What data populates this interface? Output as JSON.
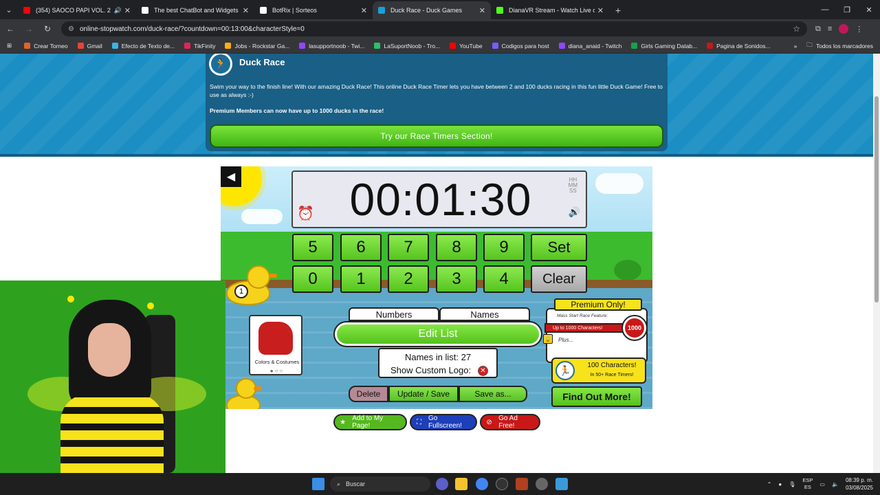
{
  "browser": {
    "tabs": [
      {
        "label": "(354) SAOCO PAPI VOL. 2",
        "color": "#ff0000",
        "active": false
      },
      {
        "label": "The best ChatBot and Widgets",
        "color": "#ffffff",
        "active": false
      },
      {
        "label": "BotRix | Sorteos",
        "color": "#ffffff",
        "active": false
      },
      {
        "label": "Duck Race - Duck Games",
        "color": "#1aa0d8",
        "active": true
      },
      {
        "label": "DianaVR Stream - Watch Live o",
        "color": "#53fc18",
        "active": false
      }
    ],
    "url": "online-stopwatch.com/duck-race/?countdown=00:13:00&characterStyle=0",
    "bookmarks": [
      {
        "label": "Crear Torneo",
        "color": "#e0632a"
      },
      {
        "label": "Gmail",
        "color": "#ea4335"
      },
      {
        "label": "Efecto de Texto de...",
        "color": "#3bb3e6"
      },
      {
        "label": "TikFinity",
        "color": "#e2245a"
      },
      {
        "label": "Jobs - Rockstar Ga...",
        "color": "#fcaf17"
      },
      {
        "label": "lasupportnoob - Twi...",
        "color": "#9146ff"
      },
      {
        "label": "LaSuportNoob - Tro...",
        "color": "#2bbf6a"
      },
      {
        "label": "YouTube",
        "color": "#ff0000"
      },
      {
        "label": "Codigos para host",
        "color": "#7b5cff"
      },
      {
        "label": "diana_anaid - Twitch",
        "color": "#9146ff"
      },
      {
        "label": "Girls Gaming Datab...",
        "color": "#16a34a"
      },
      {
        "label": "Pagina de Sonidos...",
        "color": "#c81818"
      }
    ],
    "all_bookmarks": "Todos los marcadores"
  },
  "hero": {
    "title": "Duck Race",
    "description": "Swim your way to the finish line! With our amazing Duck Race! This online Duck Race Timer lets you have between 2 and 100 ducks racing in this fun little Duck Game! Free to use as always :-)",
    "premium": "Premium Members can now have up to 1000 ducks in the race!",
    "cta": "Try our Race Timers Section!"
  },
  "game": {
    "timer": "00:01:30",
    "format": [
      "HH",
      "MM",
      "SS"
    ],
    "keys_row1": [
      "5",
      "6",
      "7",
      "8",
      "9",
      "Set"
    ],
    "keys_row2": [
      "0",
      "1",
      "2",
      "3",
      "4",
      "Clear"
    ],
    "duck_number": "1",
    "costume_label": "Colors & Costumes",
    "tab_numbers": "Numbers",
    "tab_names": "Names",
    "edit_list": "Edit List",
    "names_in_list": "Names in list: 27",
    "show_custom_logo": "Show Custom Logo:",
    "btn_delete": "Delete",
    "btn_update": "Update / Save",
    "btn_save_as": "Save as...",
    "premium_only": "Premium Only!",
    "mass_start": "Mass Start Race Feature:",
    "up_to": "Up to 1000 Characters!",
    "thousand": "1000",
    "plus": "Plus...",
    "hundred_a": "100 Characters!",
    "hundred_b": "In 50+ Race Timers!",
    "find_out": "Find Out More!"
  },
  "sub_buttons": {
    "add": "Add to My Page!",
    "fullscreen": "Go Fullscreen!",
    "adfree": "Go Ad Free!"
  },
  "taskbar": {
    "search": "Buscar",
    "lang1": "ESP",
    "lang2": "ES",
    "time": "08:39 p. m.",
    "date": "03/08/2025"
  }
}
